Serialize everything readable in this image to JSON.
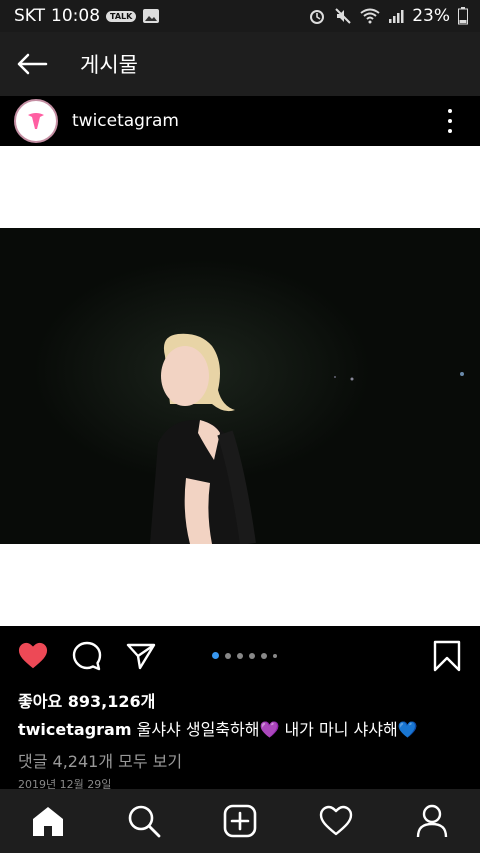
{
  "status": {
    "carrier": "SKT",
    "time": "10:08",
    "talk_badge": "TALK",
    "battery": "23%"
  },
  "appbar": {
    "title": "게시물"
  },
  "post": {
    "username": "twicetagram",
    "likes": "좋아요 893,126개",
    "caption_user": "twicetagram",
    "caption_text": " 울샤샤 생일축하해💜 내가 마니 샤샤해💙",
    "comments": "댓글 4,241개 모두 보기",
    "date": "2019년 12월 29일",
    "carousel_dots": 5,
    "carousel_active": 0
  },
  "colors": {
    "like": "#ed4956",
    "carousel_active": "#3897f0",
    "background": "#000000"
  },
  "icons": [
    "back-arrow-icon",
    "more-vert-icon",
    "heart-icon",
    "comment-icon",
    "share-icon",
    "bookmark-icon",
    "home-icon",
    "search-icon",
    "add-icon",
    "activity-heart-icon",
    "profile-icon"
  ]
}
